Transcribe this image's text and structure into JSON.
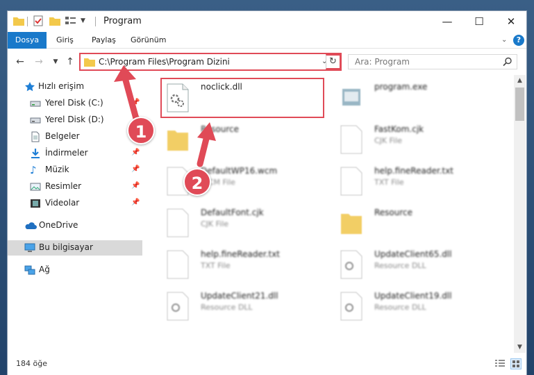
{
  "window": {
    "title": "Program",
    "controls": {
      "minimize": "—",
      "maximize": "☐",
      "close": "✕"
    }
  },
  "ribbon": {
    "tabs": [
      "Dosya",
      "Giriş",
      "Paylaş",
      "Görünüm"
    ],
    "active_tab": "Dosya",
    "help": "?"
  },
  "address": {
    "path": "C:\\Program Files\\Program Dizini",
    "search_placeholder": "Ara: Program"
  },
  "sidebar": {
    "items": [
      {
        "label": "Hızlı erişim",
        "icon": "star-icon"
      },
      {
        "label": "Yerel Disk (C:)",
        "icon": "drive-icon"
      },
      {
        "label": "Yerel Disk (D:)",
        "icon": "drive-icon"
      },
      {
        "label": "Belgeler",
        "icon": "document-icon"
      },
      {
        "label": "İndirmeler",
        "icon": "download-icon"
      },
      {
        "label": "Müzik",
        "icon": "music-icon"
      },
      {
        "label": "Resimler",
        "icon": "pictures-icon"
      },
      {
        "label": "Videolar",
        "icon": "video-icon"
      },
      {
        "label": "OneDrive",
        "icon": "cloud-icon"
      },
      {
        "label": "Bu bilgisayar",
        "icon": "computer-icon"
      },
      {
        "label": "Ağ",
        "icon": "network-icon"
      }
    ]
  },
  "files": [
    {
      "name": "noclick.dll",
      "sub": "",
      "icon": "dll-icon"
    },
    {
      "name": "program.exe",
      "sub": "",
      "icon": "exe-icon"
    },
    {
      "name": "Resource",
      "sub": "",
      "icon": "folder-icon"
    },
    {
      "name": "FastKom.cjk",
      "sub": "CJK File",
      "icon": "file-icon"
    },
    {
      "name": "DefaultWP16.wcm",
      "sub": "WCM File",
      "icon": "file-icon"
    },
    {
      "name": "help.fineReader.txt",
      "sub": "TXT File",
      "icon": "file-icon"
    },
    {
      "name": "DefaultFont.cjk",
      "sub": "CJK File",
      "icon": "file-icon"
    },
    {
      "name": "Resource",
      "sub": "",
      "icon": "folder-icon"
    },
    {
      "name": "help.fineReader.txt",
      "sub": "TXT File",
      "icon": "file-icon"
    },
    {
      "name": "UpdateClient65.dll",
      "sub": "Resource DLL",
      "icon": "dll-icon"
    },
    {
      "name": "UpdateClient21.dll",
      "sub": "Resource DLL",
      "icon": "dll-icon"
    },
    {
      "name": "UpdateClient19.dll",
      "sub": "Resource DLL",
      "icon": "dll-icon"
    }
  ],
  "status": {
    "count_text": "184 öğe"
  },
  "annotations": {
    "step1": "1",
    "step2": "2"
  },
  "colors": {
    "accent": "#1979ca",
    "highlight": "#e04a57"
  }
}
